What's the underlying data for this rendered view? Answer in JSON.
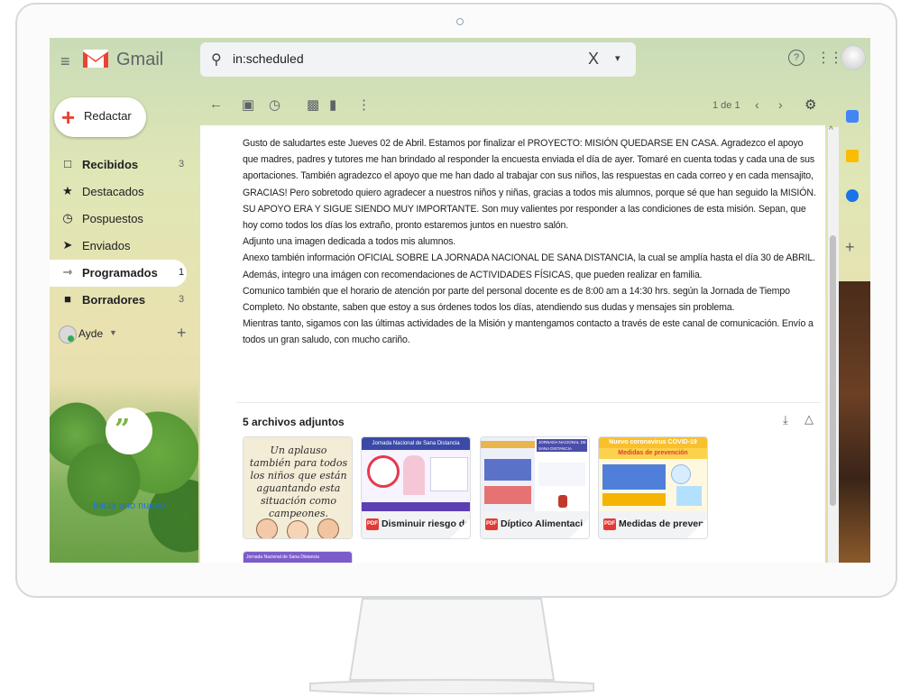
{
  "app": {
    "name": "Gmail"
  },
  "search": {
    "query": "in:scheduled",
    "clear": "X",
    "options": "▾"
  },
  "header": {
    "help": "?",
    "apps": "⋮⋮⋮"
  },
  "compose": {
    "label": "Redactar"
  },
  "sidebar": {
    "items": [
      {
        "label": "Recibidos",
        "count": "3",
        "bold": true,
        "icon": "inbox-icon"
      },
      {
        "label": "Destacados",
        "count": "",
        "bold": false,
        "icon": "star-icon"
      },
      {
        "label": "Pospuestos",
        "count": "",
        "bold": false,
        "icon": "clock-icon"
      },
      {
        "label": "Enviados",
        "count": "",
        "bold": false,
        "icon": "send-icon"
      },
      {
        "label": "Programados",
        "count": "1",
        "bold": true,
        "icon": "scheduled-icon"
      },
      {
        "label": "Borradores",
        "count": "3",
        "bold": true,
        "icon": "draft-icon"
      }
    ],
    "user": {
      "name": "Ayde",
      "caret": "▼",
      "add": "+"
    },
    "hangouts_link": "Inicia uno nuevo"
  },
  "toolbar": {
    "page_count": "1 de 1",
    "prev": "‹",
    "next": "›"
  },
  "email": {
    "paragraphs": [
      "Gusto de saludartes este Jueves 02 de Abril. Estamos por finalizar el PROYECTO: MISIÓN QUEDARSE EN CASA. Agradezco el apoyo que madres, padres y tutores me han brindado al responder la encuesta enviada el día de ayer. Tomaré en cuenta todas y cada una de sus aportaciones. También agradezco el apoyo que me han dado al trabajar con sus niños, las respuestas en cada correo y en cada mensajito, GRACIAS! Pero sobretodo quiero agradecer a nuestros niños y niñas, gracias a todos mis alumnos, porque sé que han seguido la MISIÓN. SU APOYO ERA Y SIGUE SIENDO MUY IMPORTANTE. Son muy valientes por responder a las condiciones de esta misión. Sepan, que hoy como todos los días los extraño, pronto estaremos juntos en nuestro salón.",
      "Adjunto una imagen dedicada a todos mis alumnos.",
      "Anexo también información OFICIAL SOBRE LA JORNADA NACIONAL DE SANA DISTANCIA, la cual se amplía hasta el día 30 de ABRIL.",
      "Además, integro una imágen con recomendaciones de ACTIVIDADES FÍSICAS, que pueden realizar en familia.",
      "Comunico también que el horario de atención por parte del personal docente es de 8:00 am a 14:30 hrs. según la Jornada de Tiempo Completo. No obstante, saben que estoy a sus órdenes todos los días, atendiendo sus dudas y mensajes sin problema.",
      "Mientras tanto, sigamos con las últimas actividades de la Misión y mantengamos contacto a través de este canal de comunicación. Envío a todos un gran saludo, con mucho cariño."
    ],
    "attachments_heading": "5 archivos adjuntos",
    "attachments": [
      {
        "name": "",
        "type": "image",
        "thumb_text": "Un aplauso también para todos los niños que están aguantando esta situación como campeones."
      },
      {
        "name": "Disminuir riesgo de...",
        "type": "PDF",
        "thumb_title": "Jornada Nacional de Sana Distancia"
      },
      {
        "name": "Díptico Alimentaci...",
        "type": "PDF",
        "thumb_title": "JORNADA NACIONAL DE SANA DISTANCIA"
      },
      {
        "name": "Medidas de preven...",
        "type": "PDF",
        "thumb_title": "Nuevo coronavirus COVID-19",
        "thumb_sub": "Medidas de prevención"
      },
      {
        "name": "",
        "type": "image",
        "thumb_title": "Jornada Nacional de Sana Distancia"
      }
    ]
  },
  "colors": {
    "gmail_red": "#ea4335",
    "accent_blue": "#1a73e8"
  }
}
